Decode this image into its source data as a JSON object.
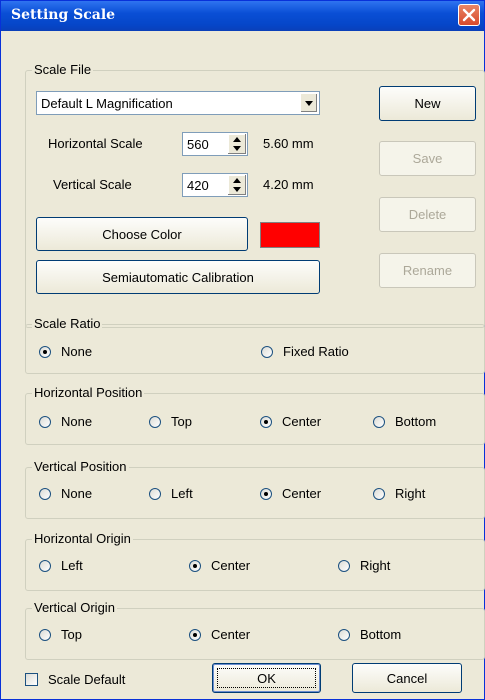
{
  "window": {
    "title": "Setting Scale"
  },
  "scale_file": {
    "legend": "Scale File",
    "selected": "Default L Magnification",
    "horizontal_label": "Horizontal Scale",
    "horizontal_value": "560",
    "horizontal_mm": "5.60 mm",
    "vertical_label": "Vertical Scale",
    "vertical_value": "420",
    "vertical_mm": "4.20 mm",
    "choose_color": "Choose Color",
    "color": "#ff0000",
    "calibration": "Semiautomatic Calibration",
    "new": "New",
    "save": "Save",
    "delete": "Delete",
    "rename": "Rename"
  },
  "scale_ratio": {
    "legend": "Scale Ratio",
    "options": [
      "None",
      "Fixed Ratio"
    ],
    "selected": "None"
  },
  "horizontal_position": {
    "legend": "Horizontal Position",
    "options": [
      "None",
      "Top",
      "Center",
      "Bottom"
    ],
    "selected": "Center"
  },
  "vertical_position": {
    "legend": "Vertical Position",
    "options": [
      "None",
      "Left",
      "Center",
      "Right"
    ],
    "selected": "Center"
  },
  "horizontal_origin": {
    "legend": "Horizontal Origin",
    "options": [
      "Left",
      "Center",
      "Right"
    ],
    "selected": "Center"
  },
  "vertical_origin": {
    "legend": "Vertical Origin",
    "options": [
      "Top",
      "Center",
      "Bottom"
    ],
    "selected": "Center"
  },
  "footer": {
    "scale_default": "Scale Default",
    "ok": "OK",
    "cancel": "Cancel"
  }
}
